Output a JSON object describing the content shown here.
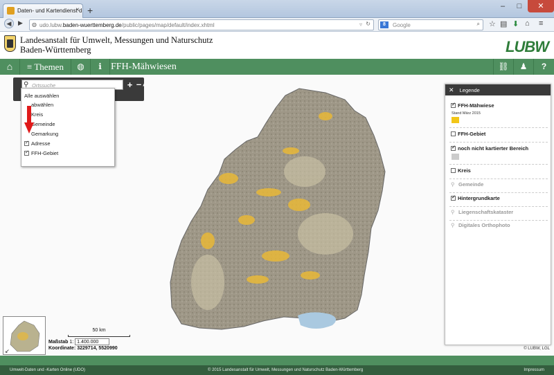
{
  "browser": {
    "tab_title": "Daten- und Kartendienst d...",
    "tab_close": "×",
    "new_tab": "+",
    "url_prefix": "udo.lubw.",
    "url_domain": "baden-wuerttemberg.de",
    "url_path": "/public/pages/map/default/index.xhtml",
    "search_placeholder": "Google",
    "window_controls": {
      "minimize": "–",
      "maximize": "□",
      "close": "✕"
    }
  },
  "header": {
    "org_line1": "Landesanstalt für Umwelt, Messungen und Naturschutz",
    "org_line2": "Baden-Württemberg",
    "logo_text": "LUBW"
  },
  "appbar": {
    "home_icon": "⌂",
    "menu_icon": "≡",
    "themes_label": "Themen",
    "globe_icon": "◍",
    "info_icon": "ℹ",
    "page_title": "FFH-Mähwiesen",
    "link_icon": "⛓",
    "user_icon": "♟",
    "help_icon": "?"
  },
  "search": {
    "placeholder": "Ortssuche",
    "zoom_in": "+",
    "zoom_out": "–",
    "collapse": "^"
  },
  "dropdown": {
    "select_all": "Alle auswählen",
    "deselect_all": "abwählen",
    "items": [
      {
        "label": "Kreis",
        "checked": false
      },
      {
        "label": "Gemeinde",
        "checked": false
      },
      {
        "label": "Gemarkung",
        "checked": false
      },
      {
        "label": "Adresse",
        "checked": true
      },
      {
        "label": "FFH-Gebiet",
        "checked": true
      }
    ]
  },
  "scale": {
    "bar_label": "50 km",
    "massstab_label": "Maßstab",
    "ratio_prefix": "1:",
    "ratio_value": "1.400.000",
    "coord_label": "Koordinate:",
    "coord_value": "3229714, 5520990"
  },
  "map_copyright": "© LUBW, LGL",
  "legend": {
    "title": "Legende",
    "close_icon": "✕",
    "layers": [
      {
        "label": "FFH-Mähwiese",
        "checked": true,
        "sub": "Stand März 2015",
        "color": "#f2c618"
      },
      {
        "label": "FFH-Gebiet",
        "checked": false
      },
      {
        "label": "noch nicht kartierter Bereich",
        "checked": true,
        "color": "#cccccc"
      },
      {
        "label": "Kreis",
        "checked": false
      },
      {
        "label": "Gemeinde",
        "checked": null
      },
      {
        "label": "Hintergrundkarte",
        "checked": true
      },
      {
        "label": "Liegenschaftskataster",
        "checked": null
      },
      {
        "label": "Digitales Orthophoto",
        "checked": null
      }
    ]
  },
  "footer": {
    "left": "Umwelt-Daten und -Karten Online (UDO)",
    "center": "© 2015 Landesanstalt für Umwelt, Messungen und Naturschutz Baden-Württemberg",
    "right": "Impressum"
  },
  "colors": {
    "app_green": "#4f8f5f",
    "dark_green": "#345e3e",
    "meadow_yellow": "#f2c618"
  }
}
